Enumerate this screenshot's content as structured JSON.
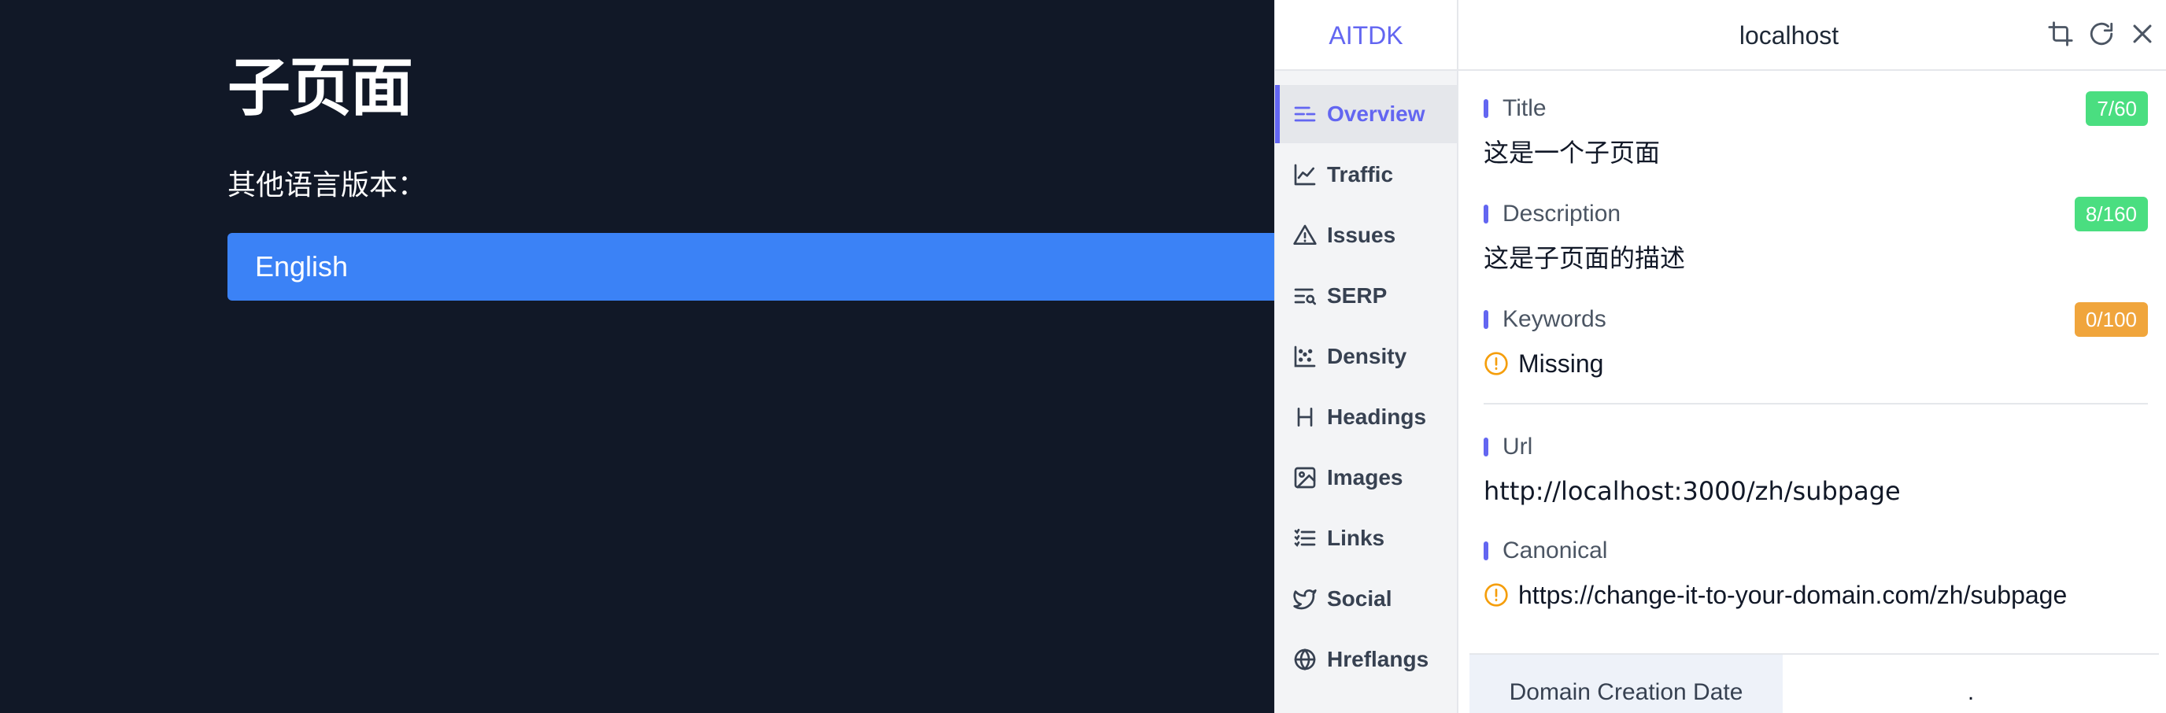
{
  "page": {
    "title": "子页面",
    "subtitle": "其他语言版本：",
    "language_button": "English"
  },
  "extension": {
    "brand": "AITDK",
    "host": "localhost",
    "top_icons": [
      "crop-icon",
      "refresh-icon",
      "close-icon"
    ],
    "sidebar": {
      "items": [
        {
          "label": "Overview",
          "icon": "overview-icon",
          "active": true
        },
        {
          "label": "Traffic",
          "icon": "traffic-chart-icon"
        },
        {
          "label": "Issues",
          "icon": "warning-triangle-icon"
        },
        {
          "label": "SERP",
          "icon": "serp-icon"
        },
        {
          "label": "Density",
          "icon": "density-scatter-icon"
        },
        {
          "label": "Headings",
          "icon": "heading-icon"
        },
        {
          "label": "Images",
          "icon": "image-icon"
        },
        {
          "label": "Links",
          "icon": "list-icon"
        },
        {
          "label": "Social",
          "icon": "twitter-icon"
        },
        {
          "label": "Hreflangs",
          "icon": "globe-icon"
        }
      ]
    },
    "overview": {
      "title_label": "Title",
      "title_badge": "7/60",
      "title_value": "这是一个子页面",
      "description_label": "Description",
      "description_badge": "8/160",
      "description_value": "这是子页面的描述",
      "keywords_label": "Keywords",
      "keywords_badge": "0/100",
      "keywords_value": "Missing",
      "url_label": "Url",
      "url_value": "http://localhost:3000/zh/subpage",
      "canonical_label": "Canonical",
      "canonical_value": "https://change-it-to-your-domain.com/zh/subpage",
      "domain_creation_label": "Domain Creation Date",
      "domain_creation_value": "."
    },
    "colors": {
      "accent": "#6366f1",
      "badge_ok": "#4ade80",
      "badge_warn": "#f0a53c",
      "warn_icon": "#f59e0b",
      "page_bg": "#111827",
      "button_blue": "#3b82f6"
    }
  }
}
